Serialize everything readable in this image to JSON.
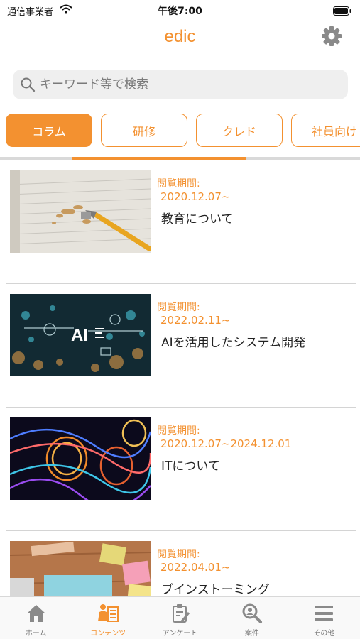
{
  "status_bar": {
    "carrier": "通信事業者",
    "time": "午後7:00"
  },
  "header": {
    "title": "edic",
    "settings_icon": "gear-icon"
  },
  "search": {
    "placeholder": "キーワード等で検索",
    "value": ""
  },
  "tabs": [
    {
      "label": "コラム",
      "active": true
    },
    {
      "label": "研修",
      "active": false
    },
    {
      "label": "クレド",
      "active": false
    },
    {
      "label": "社員向け",
      "active": false
    }
  ],
  "items": [
    {
      "period_label": "閲覧期間:",
      "period": "2020.12.07~",
      "title": "教育について",
      "image": "pencil-shavings-on-notebook"
    },
    {
      "period_label": "閲覧期間:",
      "period": "2022.02.11~",
      "title": "AIを活用したシステム開発",
      "image": "ai-technology-graphic",
      "image_text": "AI"
    },
    {
      "period_label": "閲覧期間:",
      "period": "2020.12.07~2024.12.01",
      "title": "ITについて",
      "image": "abstract-light-rings"
    },
    {
      "period_label": "閲覧期間:",
      "period": "2022.04.01~",
      "title": "ブインストーミング",
      "image": "sticky-notes-on-desk"
    }
  ],
  "tab_bar": [
    {
      "label": "ホーム",
      "icon": "home-icon",
      "active": false
    },
    {
      "label": "コンテンツ",
      "icon": "contents-icon",
      "active": true
    },
    {
      "label": "アンケート",
      "icon": "survey-icon",
      "active": false
    },
    {
      "label": "案件",
      "icon": "search-project-icon",
      "active": false
    },
    {
      "label": "その他",
      "icon": "menu-icon",
      "active": false
    }
  ],
  "colors": {
    "accent": "#f39130",
    "search_bg": "#efefef",
    "tab_bar_bg": "#f9f9f9",
    "inactive_icon": "#8a8a8a"
  }
}
